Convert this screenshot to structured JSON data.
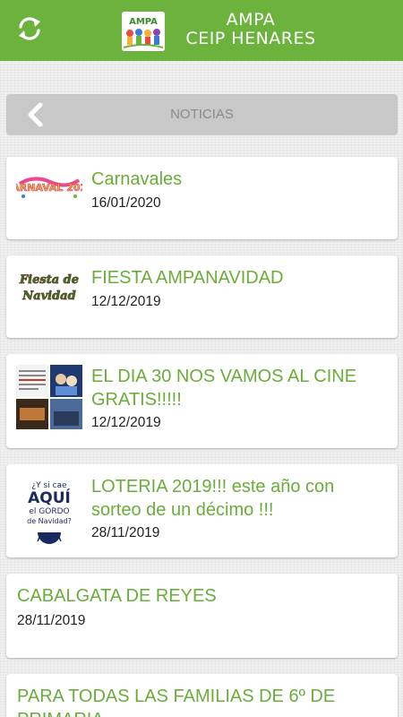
{
  "header": {
    "title_line1": "AMPA",
    "title_line2": "CEIP HENARES",
    "logo_text": "AMPA"
  },
  "section": {
    "title": "NOTICIAS"
  },
  "news": [
    {
      "title": "Carnavales",
      "date": "16/01/2020",
      "thumb_text": "CARNAVAL 2020"
    },
    {
      "title": "FIESTA AMPANAVIDAD",
      "date": "12/12/2019",
      "thumb_text": "Fiesta de Navidad"
    },
    {
      "title_line1": "EL DIA 30 NOS VAMOS AL CINE",
      "title_line2": "GRATIS!!!!!",
      "date": "12/12/2019"
    },
    {
      "title_line1": "LOTERIA 2019!!! este año con",
      "title_line2": "sorteo de un décimo !!!",
      "date": "28/11/2019",
      "thumb_lines": [
        "¿Y si cae",
        "AQUÍ",
        "el GORDO",
        "de Navidad?"
      ]
    },
    {
      "title": "CABALGATA DE REYES",
      "date": "28/11/2019"
    },
    {
      "title_line1": "PARA TODAS LAS FAMILIAS DE 6º DE",
      "title_line2": "PRIMARIA"
    }
  ],
  "colors": {
    "brand_green": "#6cb33e",
    "title_green": "#6aad3a",
    "section_bar": "#c8c8c8"
  },
  "icons": {
    "refresh": "refresh-icon",
    "back": "chevron-left-icon"
  }
}
